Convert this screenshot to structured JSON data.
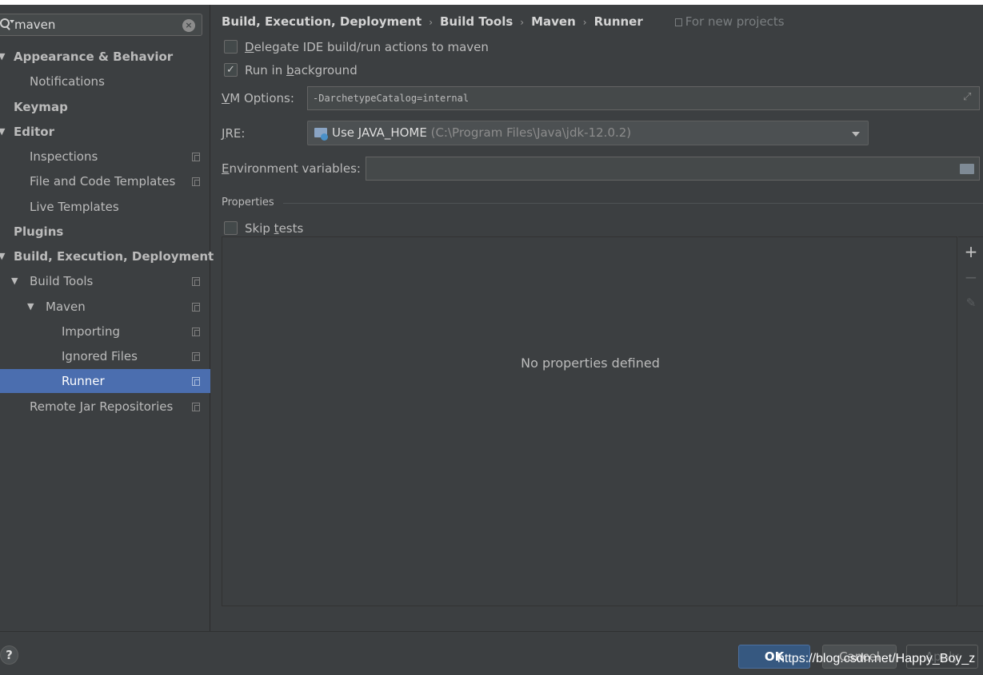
{
  "search": {
    "value": "maven"
  },
  "sidebar": {
    "items": [
      {
        "label": "Appearance & Behavior"
      },
      {
        "label": "Notifications"
      },
      {
        "label": "Keymap"
      },
      {
        "label": "Editor"
      },
      {
        "label": "Inspections"
      },
      {
        "label": "File and Code Templates"
      },
      {
        "label": "Live Templates"
      },
      {
        "label": "Plugins"
      },
      {
        "label": "Build, Execution, Deployment"
      },
      {
        "label": "Build Tools"
      },
      {
        "label": "Maven"
      },
      {
        "label": "Importing"
      },
      {
        "label": "Ignored Files"
      },
      {
        "label": "Runner"
      },
      {
        "label": "Remote Jar Repositories"
      }
    ],
    "expand_arrow": "▼"
  },
  "breadcrumb": {
    "items": [
      "Build, Execution, Deployment",
      "Build Tools",
      "Maven",
      "Runner"
    ],
    "separator": "›",
    "scope": "For new projects"
  },
  "options": {
    "delegate": {
      "prefix": "",
      "mnemonic": "D",
      "suffix": "elegate IDE build/run actions to maven",
      "checked": false
    },
    "background": {
      "prefix": "Run in ",
      "mnemonic": "b",
      "suffix": "ackground",
      "checked": true,
      "checkmark": "✓"
    }
  },
  "vm_options": {
    "label_mnemonic": "V",
    "label_rest": "M Options:",
    "value": "-DarchetypeCatalog=internal"
  },
  "jre": {
    "label_mnemonic": "J",
    "label_rest": "RE:",
    "selected_main": "Use JAVA_HOME",
    "selected_sub": "(C:\\Program Files\\Java\\jdk-12.0.2)"
  },
  "env": {
    "label_mnemonic": "E",
    "label_rest": "nvironment variables:",
    "value": ""
  },
  "properties": {
    "title": "Properties",
    "skip_tests": {
      "prefix": "Skip ",
      "mnemonic": "t",
      "suffix": "ests",
      "checked": false
    },
    "empty_text": "No properties defined",
    "add_symbol": "+",
    "remove_symbol": "−",
    "edit_symbol": "✎"
  },
  "footer": {
    "help": "?",
    "ok": "OK",
    "cancel": "Cancel",
    "apply": "Apply",
    "watermark": "https://blog.csdn.net/Happy_Boy_z"
  },
  "colors": {
    "selection": "#4b6eaf",
    "background": "#3c3f41",
    "ok_button": "#365880"
  }
}
